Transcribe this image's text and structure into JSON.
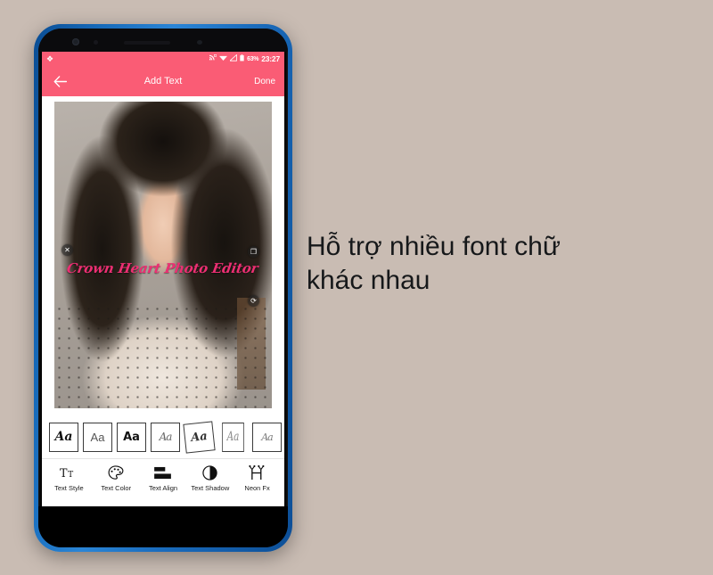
{
  "background_color": "#c9bcb3",
  "caption": {
    "line1": "Hỗ trợ nhiều font chữ",
    "line2": "khác nhau"
  },
  "phone": {
    "bezel_color": "#1669b8",
    "frame_color": "#000000"
  },
  "status_bar": {
    "background_color": "#fa5c75",
    "app_badge_icon": "app-badge-icon",
    "cast_icon": "cast-screen-icon",
    "wifi_icon": "wifi-icon",
    "signal_icon": "signal-bars-icon",
    "battery_icon": "battery-icon",
    "battery_percent": "63%",
    "clock": "23:27"
  },
  "app_bar": {
    "background_color": "#fa5c75",
    "back_icon": "back-arrow-icon",
    "title": "Add Text",
    "done_label": "Done"
  },
  "canvas": {
    "overlay_text": "Crown Heart Photo Editor",
    "overlay_text_color": "#ec2f73",
    "close_handle_glyph": "✕",
    "edit_handle_glyph": "❐",
    "resize_handle_glyph": "⟳"
  },
  "font_tiles": [
    {
      "label": "Aa",
      "name": "font-tile-serif-italic"
    },
    {
      "label": "Aa",
      "name": "font-tile-sans-light"
    },
    {
      "label": "Aa",
      "name": "font-tile-sans-bold"
    },
    {
      "label": "Aa",
      "name": "font-tile-script-1"
    },
    {
      "label": "Aa",
      "name": "font-tile-script-2"
    },
    {
      "label": "Aa",
      "name": "font-tile-script-3"
    },
    {
      "label": "Aa",
      "name": "font-tile-script-4"
    }
  ],
  "tools": [
    {
      "label": "Text Style",
      "icon": "text-style-icon"
    },
    {
      "label": "Text Color",
      "icon": "text-color-palette-icon"
    },
    {
      "label": "Text Align",
      "icon": "text-align-icon"
    },
    {
      "label": "Text Shadow",
      "icon": "text-shadow-icon"
    },
    {
      "label": "Neon Fx",
      "icon": "neon-fx-sparkle-icon"
    }
  ]
}
